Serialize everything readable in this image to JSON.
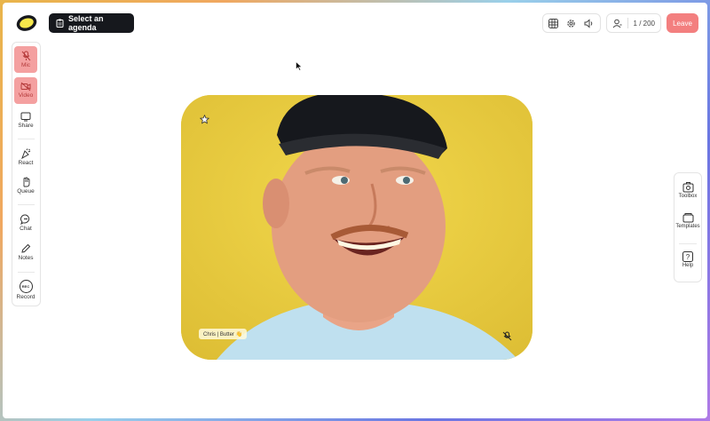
{
  "header": {
    "agenda_label": "Select an agenda",
    "participants": "1 / 200",
    "leave_label": "Leave"
  },
  "toolbar_left": {
    "items": [
      {
        "label": "Mic",
        "icon": "mic-off-icon",
        "state": "off"
      },
      {
        "label": "Video",
        "icon": "video-off-icon",
        "state": "off"
      },
      {
        "label": "Share",
        "icon": "share-screen-icon"
      },
      {
        "label": "React",
        "icon": "react-icon"
      },
      {
        "label": "Queue",
        "icon": "raise-hand-icon"
      },
      {
        "label": "Chat",
        "icon": "chat-icon"
      },
      {
        "label": "Notes",
        "icon": "pencil-icon"
      },
      {
        "label": "Record",
        "icon": "record-icon",
        "badge": "REC"
      }
    ]
  },
  "toolbar_right": {
    "items": [
      {
        "label": "Toolbox",
        "icon": "toolbox-icon"
      },
      {
        "label": "Templates",
        "icon": "templates-icon"
      },
      {
        "label": "Help",
        "icon": "help-icon"
      }
    ]
  },
  "video": {
    "participant_name": "Chris | Butter 👋",
    "muted": true
  },
  "colors": {
    "accent_dark": "#16181d",
    "leave": "#f37f7f",
    "off_state": "#f4a0a0",
    "video_bg": "#e8cb3c"
  }
}
